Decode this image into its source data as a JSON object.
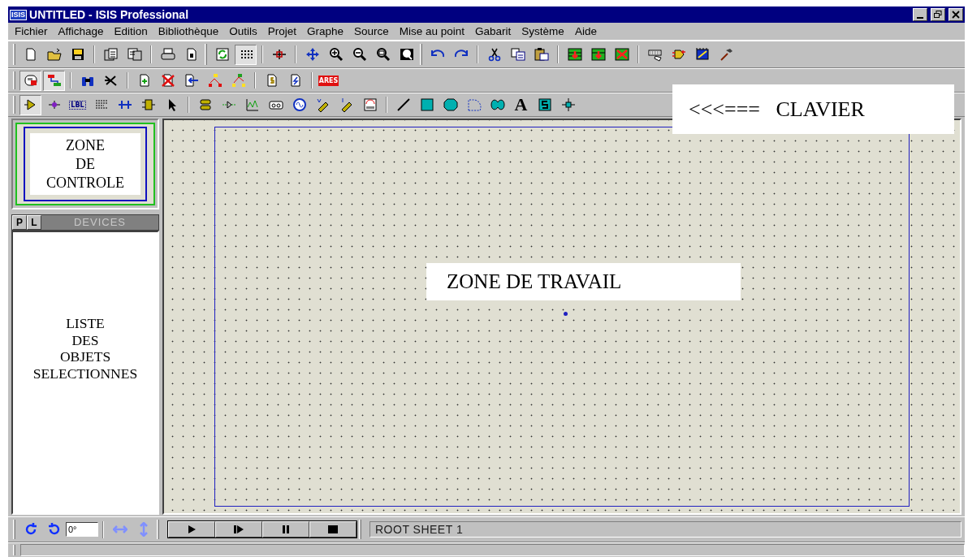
{
  "window": {
    "title": "UNTITLED - ISIS Professional",
    "app_badge": "ISIS"
  },
  "menu": [
    {
      "label": "Fichier"
    },
    {
      "label": "Affichage"
    },
    {
      "label": "Edition"
    },
    {
      "label": "Bibliothèque"
    },
    {
      "label": "Outils"
    },
    {
      "label": "Projet"
    },
    {
      "label": "Graphe"
    },
    {
      "label": "Source"
    },
    {
      "label": "Mise au point"
    },
    {
      "label": "Gabarit"
    },
    {
      "label": "Système"
    },
    {
      "label": "Aide"
    }
  ],
  "toolbars": [
    {
      "sections": [
        [
          [
            {
              "selected": false
            },
            {
              "selected": false
            },
            {
              "selected": false
            }
          ],
          [
            {
              "selected": false
            },
            {
              "selected": false
            }
          ],
          [
            {
              "selected": false
            },
            {
              "selected": false
            }
          ]
        ],
        [
          [
            {
              "selected": false
            },
            {
              "selected": true
            }
          ],
          [
            {
              "selected": false
            }
          ],
          [
            {
              "selected": false
            },
            {
              "selected": false
            },
            {
              "selected": false
            },
            {
              "selected": false
            },
            {
              "selected": false
            }
          ]
        ],
        [
          [
            {
              "selected": false
            },
            {
              "selected": false
            }
          ],
          [
            {
              "selected": false
            },
            {
              "selected": false
            },
            {
              "selected": false
            }
          ],
          [
            {
              "selected": false
            },
            {
              "selected": false
            },
            {
              "selected": false
            }
          ],
          [
            {
              "selected": false
            },
            {
              "selected": false
            },
            {
              "selected": false
            },
            {
              "selected": false
            }
          ]
        ]
      ]
    },
    {
      "sections": [
        [
          [
            {
              "selected": true
            },
            {
              "selected": true
            }
          ],
          [
            {
              "selected": false
            },
            {
              "selected": false
            }
          ],
          [
            {
              "selected": false
            },
            {
              "selected": false
            },
            {
              "selected": false
            },
            {
              "selected": false
            },
            {
              "selected": false
            }
          ],
          [
            {
              "selected": false
            },
            {
              "selected": false
            }
          ],
          [
            {
              "selected": false,
              "text": "ARES"
            }
          ]
        ]
      ]
    },
    {
      "sections": [
        [
          [
            {
              "selected": true
            },
            {
              "selected": false
            },
            {
              "selected": false,
              "text": "LBL"
            },
            {
              "selected": false
            },
            {
              "selected": false
            },
            {
              "selected": false
            },
            {
              "selected": false
            }
          ],
          [
            {
              "selected": false
            },
            {
              "selected": false
            },
            {
              "selected": false
            },
            {
              "selected": false
            },
            {
              "selected": false
            },
            {
              "selected": false
            },
            {
              "selected": false
            },
            {
              "selected": false
            }
          ],
          [
            {
              "selected": false
            },
            {
              "selected": false
            },
            {
              "selected": false
            },
            {
              "selected": false
            },
            {
              "selected": false
            },
            {
              "selected": false,
              "text": "A"
            },
            {
              "selected": false
            },
            {
              "selected": false
            }
          ]
        ]
      ]
    }
  ],
  "annotations": {
    "keyboard": "<<<===   CLAVIER",
    "workspace": "ZONE DE TRAVAIL"
  },
  "control_zone": {
    "lines": [
      "ZONE",
      "DE",
      "CONTROLE"
    ]
  },
  "devices": {
    "tabs": [
      {
        "label": "P",
        "selected": false
      },
      {
        "label": "L",
        "selected": false
      }
    ],
    "title": "DEVICES",
    "lines": [
      "LISTE",
      "DES",
      "OBJETS",
      "SELECTIONNES"
    ]
  },
  "bottom_bar": {
    "angle": "0°",
    "mirror_disabled": true,
    "sheet": "ROOT SHEET 1"
  }
}
